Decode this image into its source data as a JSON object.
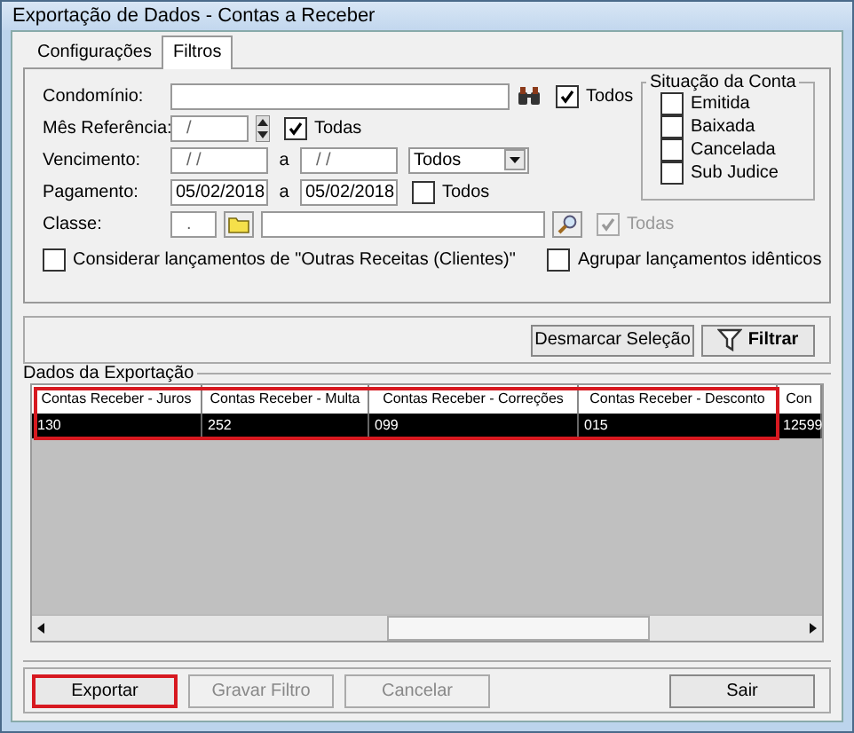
{
  "window": {
    "title": "Exportação de Dados - Contas a Receber"
  },
  "tabs": [
    {
      "label": "Configurações",
      "selected": false
    },
    {
      "label": "Filtros",
      "selected": true
    }
  ],
  "condominio": {
    "label": "Condomínio:",
    "all": {
      "label": "Todos",
      "checked": true,
      "disabled": false
    }
  },
  "mes_referencia": {
    "label": "Mês Referência:",
    "value": "/",
    "all": {
      "label": "Todas",
      "checked": true,
      "disabled": false
    }
  },
  "vencimento": {
    "label": "Vencimento:",
    "from": "/ /",
    "separator": "a",
    "to": "/ /",
    "select": "Todos"
  },
  "pagamento": {
    "label": "Pagamento:",
    "from": "05/02/2018",
    "separator": "a",
    "to": "05/02/2018",
    "all": {
      "label": "Todos",
      "checked": false,
      "disabled": false
    }
  },
  "classe": {
    "label": "Classe:",
    "code": ".",
    "all": {
      "label": "Todas",
      "checked": true,
      "disabled": true
    }
  },
  "situacao": {
    "title": "Situação da Conta",
    "items": [
      {
        "label": "Emitida",
        "checked": false
      },
      {
        "label": "Baixada",
        "checked": false
      },
      {
        "label": "Cancelada",
        "checked": false
      },
      {
        "label": "Sub Judice",
        "checked": false
      }
    ]
  },
  "options": [
    {
      "label": "Considerar lançamentos de \"Outras Receitas (Clientes)\"",
      "checked": false
    },
    {
      "label": "Agrupar lançamentos idênticos",
      "checked": false
    }
  ],
  "actions": [
    {
      "label": "Desmarcar Seleção",
      "kind": "plain"
    },
    {
      "label": "Filtrar",
      "kind": "filter"
    }
  ],
  "export_data": {
    "title": "Dados da Exportação",
    "columns": [
      {
        "header": "Contas Receber - Juros",
        "highlighted": true
      },
      {
        "header": "Contas Receber - Multa",
        "highlighted": true
      },
      {
        "header": "Contas Receber - Correções",
        "highlighted": true
      },
      {
        "header": "Contas Receber - Desconto",
        "highlighted": true
      },
      {
        "header": "Con",
        "highlighted": false
      }
    ],
    "rows": [
      {
        "cells": [
          "130",
          "252",
          "099",
          "015",
          "12599"
        ],
        "selected": true
      }
    ]
  },
  "buttons": [
    {
      "label": "Exportar",
      "disabled": false,
      "highlighted": true
    },
    {
      "label": "Gravar Filtro",
      "disabled": true,
      "highlighted": false
    },
    {
      "label": "Cancelar",
      "disabled": true,
      "highlighted": false
    },
    {
      "label": "Sair",
      "disabled": false,
      "highlighted": false
    }
  ]
}
